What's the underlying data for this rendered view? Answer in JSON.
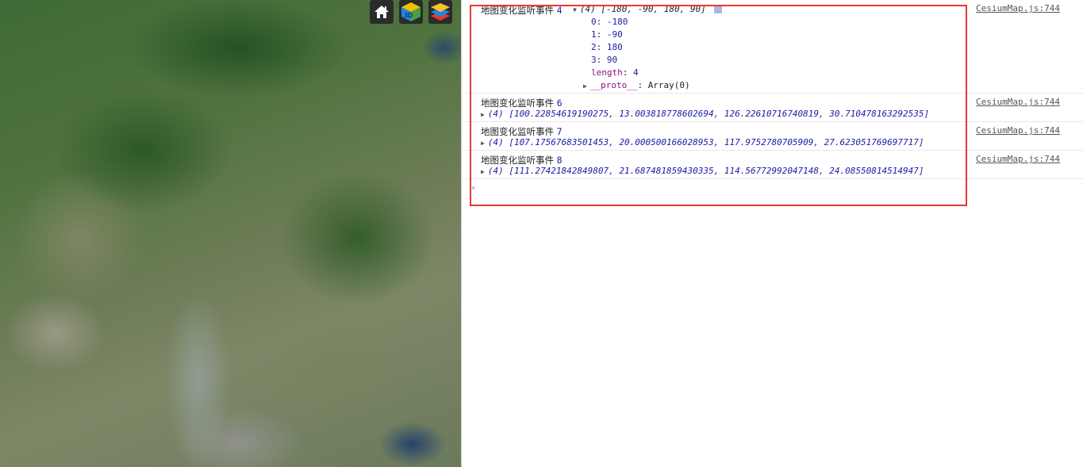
{
  "map": {
    "home_icon": "home-icon",
    "view_icon": "3d-view-icon",
    "view_label": "3D",
    "layers_icon": "layers-icon"
  },
  "colors": {
    "highlight": "#e53935",
    "number": "#1a1aa6",
    "key": "#881280"
  },
  "console": {
    "entries": [
      {
        "message": "地图变化监听事件",
        "count": "4",
        "array_summary": "(4) [-180, -90, 180, 90]",
        "source": "CesiumMap.js:744",
        "properties": [
          {
            "key": "0",
            "value": "-180"
          },
          {
            "key": "1",
            "value": "-90"
          },
          {
            "key": "2",
            "value": "180"
          },
          {
            "key": "3",
            "value": "90"
          },
          {
            "key": "length",
            "value": "4"
          },
          {
            "key": "__proto__",
            "value": "Array(0)"
          }
        ]
      },
      {
        "message": "地图变化监听事件",
        "count": "6",
        "array_summary": "(4) [100.22854619190275, 13.003818778602694, 126.22610716740819, 30.710478163292535]",
        "source": "CesiumMap.js:744"
      },
      {
        "message": "地图变化监听事件",
        "count": "7",
        "array_summary": "(4) [107.17567683501453, 20.000500166028953, 117.9752780705909, 27.623051769697717]",
        "source": "CesiumMap.js:744"
      },
      {
        "message": "地图变化监听事件",
        "count": "8",
        "array_summary": "(4) [111.27421842849807, 21.687481859430335, 114.56772992047148, 24.08550814514947]",
        "source": "CesiumMap.js:744"
      }
    ],
    "prompt": "›"
  }
}
